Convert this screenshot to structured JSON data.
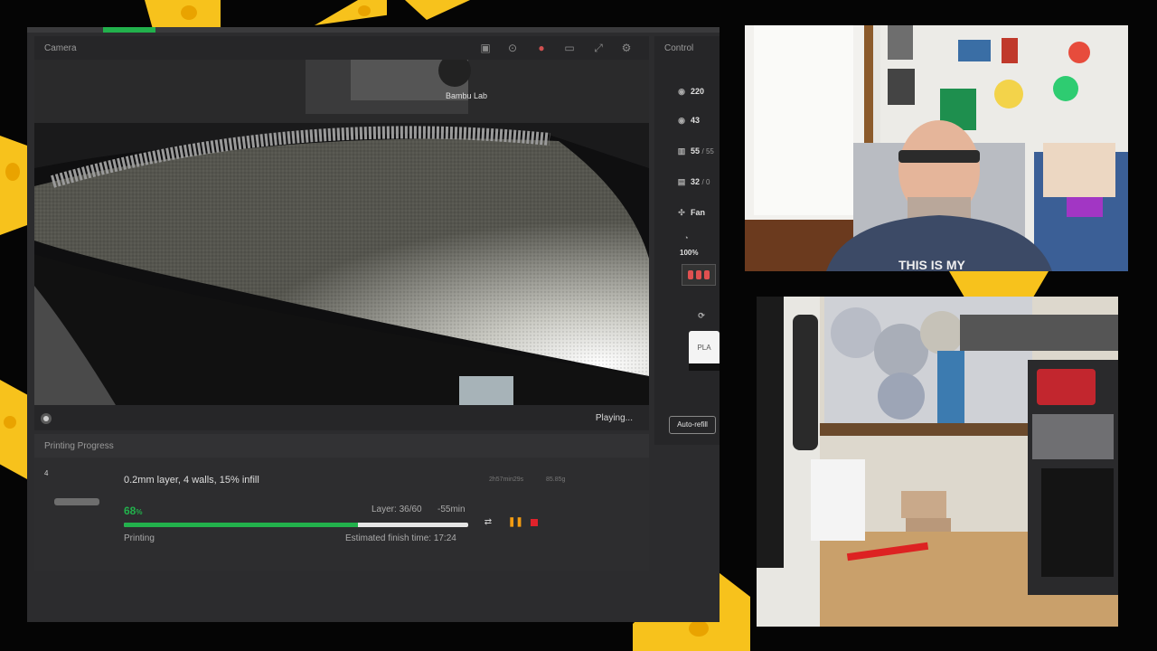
{
  "camera": {
    "title": "Camera",
    "status": "Playing...",
    "feed_brand": "Bambu Lab",
    "icons": [
      "sd-card-icon",
      "timelapse-icon",
      "record-icon",
      "video-icon",
      "fullscreen-icon",
      "settings-icon"
    ]
  },
  "control": {
    "title": "Control",
    "nozzle_temp": "220",
    "bed_temp": "43",
    "chamber": "55",
    "chamber_sub": "/ 55",
    "aux": "32",
    "aux_sub": "/ 0",
    "fan_label": "Fan",
    "speed": "100%",
    "filament": "PLA",
    "auto_refill": "Auto-refill"
  },
  "progress": {
    "header": "Printing Progress",
    "plate_number": "4",
    "job_title": "0.2mm layer, 4 walls, 15% infill",
    "duration": "2h57min29s",
    "weight": "85.85g",
    "percent": "68",
    "percent_unit": "%",
    "percent_value": 68,
    "layer": "Layer: 36/60",
    "remaining": "-55min",
    "status": "Printing",
    "eta": "Estimated finish time: 17:24"
  },
  "colors": {
    "accent_green": "#22b14c",
    "stop_red": "#e0222b",
    "pause_orange": "#f39c12",
    "cheese_yellow": "#f7c21c"
  },
  "webcams": {
    "top_shirt_text": "THIS IS MY"
  }
}
